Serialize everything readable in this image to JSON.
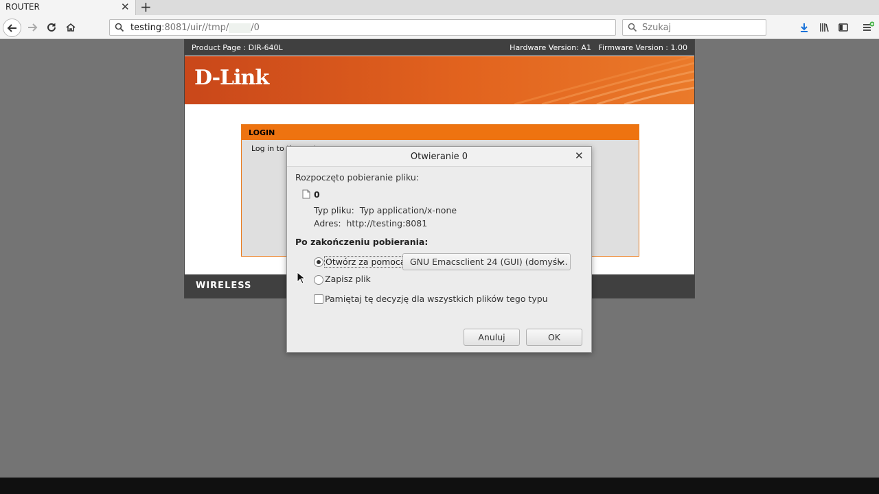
{
  "browser": {
    "tab_title": "ROUTER",
    "url_host": "testing",
    "url_rest": ":8081/uir//tmp/",
    "url_end": "/0",
    "search_placeholder": "Szukaj"
  },
  "router": {
    "product_page": "Product Page :  DIR-640L",
    "versions": "Hardware Version: A1   Firmware Version : 1.00",
    "logo": "D-Link",
    "login_title": "LOGIN",
    "login_text": "Log in to the router:",
    "footer": "WIRELESS"
  },
  "dialog": {
    "title": "Otwieranie 0",
    "started": "Rozpoczęto pobieranie pliku:",
    "file_name": "0",
    "file_type": "Typ pliku:  Typ application/x-none",
    "file_address": "Adres:  http://testing:8081",
    "after_download": "Po zakończeniu pobierania:",
    "open_with_label": "Otwórz za pomocą",
    "open_with_app": "GNU Emacsclient 24 (GUI) (domyśl...",
    "save_label": "Zapisz plik",
    "remember_label": "Pamiętaj tę decyzję dla wszystkich plików tego typu",
    "cancel_label": "Anuluj",
    "ok_label": "OK"
  },
  "colors": {
    "accent_orange": "#ee7310",
    "banner_dark": "#c9471a",
    "bar_gray": "#404040"
  }
}
